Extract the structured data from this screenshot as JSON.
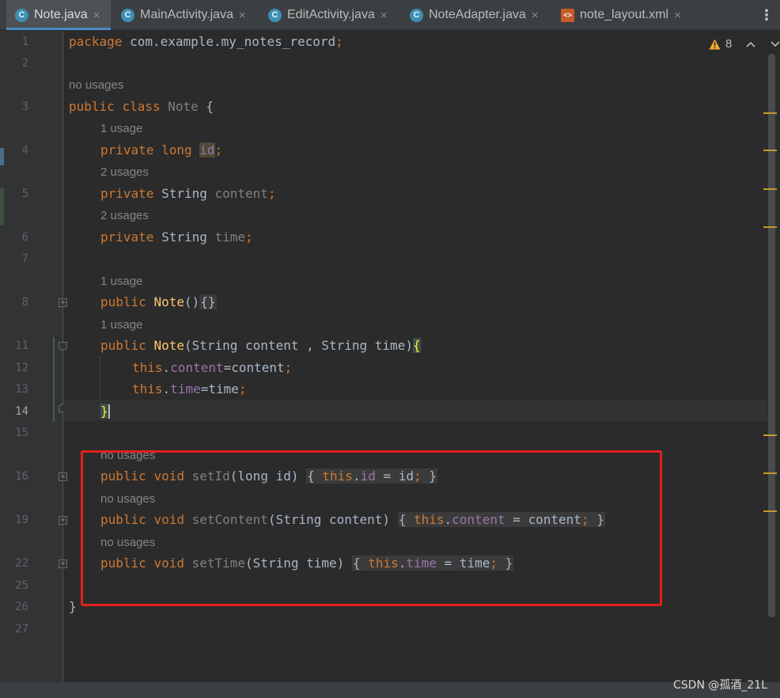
{
  "tabs": [
    {
      "label": "Note.java",
      "icon": "java-class-icon",
      "icon_glyph": "C",
      "active": true
    },
    {
      "label": "MainActivity.java",
      "icon": "java-class-icon",
      "icon_glyph": "C",
      "active": false
    },
    {
      "label": "EditActivity.java",
      "icon": "java-class-icon",
      "icon_glyph": "C",
      "active": false
    },
    {
      "label": "NoteAdapter.java",
      "icon": "java-class-icon",
      "icon_glyph": "C",
      "active": false
    },
    {
      "label": "note_layout.xml",
      "icon": "xml-file-icon",
      "icon_glyph": "<>",
      "active": false
    }
  ],
  "close_glyph": "×",
  "menu_glyph": "⋮",
  "inspections": {
    "warnings": "8",
    "up_glyph": "^",
    "down_glyph": "v"
  },
  "line_numbers": [
    "1",
    "2",
    "3",
    "4",
    "5",
    "6",
    "7",
    "8",
    "11",
    "12",
    "13",
    "14",
    "15",
    "16",
    "19",
    "22",
    "25",
    "26",
    "27"
  ],
  "hints": {
    "h1": "no usages",
    "h2": "1 usage",
    "h3": "2 usages",
    "h4": "2 usages",
    "h5": "1 usage",
    "h6": "1 usage",
    "h7": "no usages",
    "h8": "no usages",
    "h9": "no usages"
  },
  "code": {
    "package_kw": "package",
    "package_name": " com.example.my_notes_record",
    "semi": ";",
    "public": "public",
    "class": "class",
    "class_name": "Note",
    "open_brace": "{",
    "close_brace": "}",
    "private": "private",
    "long": "long",
    "void": "void",
    "this": "this",
    "String": "String",
    "f_id": "id",
    "f_content": "content",
    "f_time": "time",
    "ctor_empty": "()",
    "ctor_empty_body": "{}",
    "ctor2_params": "(String content , String time)",
    "assign_content": "=content",
    "assign_time": "=time",
    "setId": "setId",
    "setId_params": "(long id)",
    "setId_body_a": " = id",
    "setContent": "setContent",
    "setContent_params": "(String content)",
    "setContent_body_a": " = content",
    "setTime": "setTime",
    "setTime_params": "(String time)",
    "setTime_body_a": " = time",
    "dot": "."
  },
  "watermark": "CSDN @孤酒_21L",
  "colors": {
    "keyword": "#cc7832",
    "field": "#9876aa",
    "method": "#ffc66d",
    "text": "#a9b7c6",
    "highlight_box": "#e3211a",
    "warning": "#c49b2b",
    "tab_accent": "#4a88c7"
  }
}
